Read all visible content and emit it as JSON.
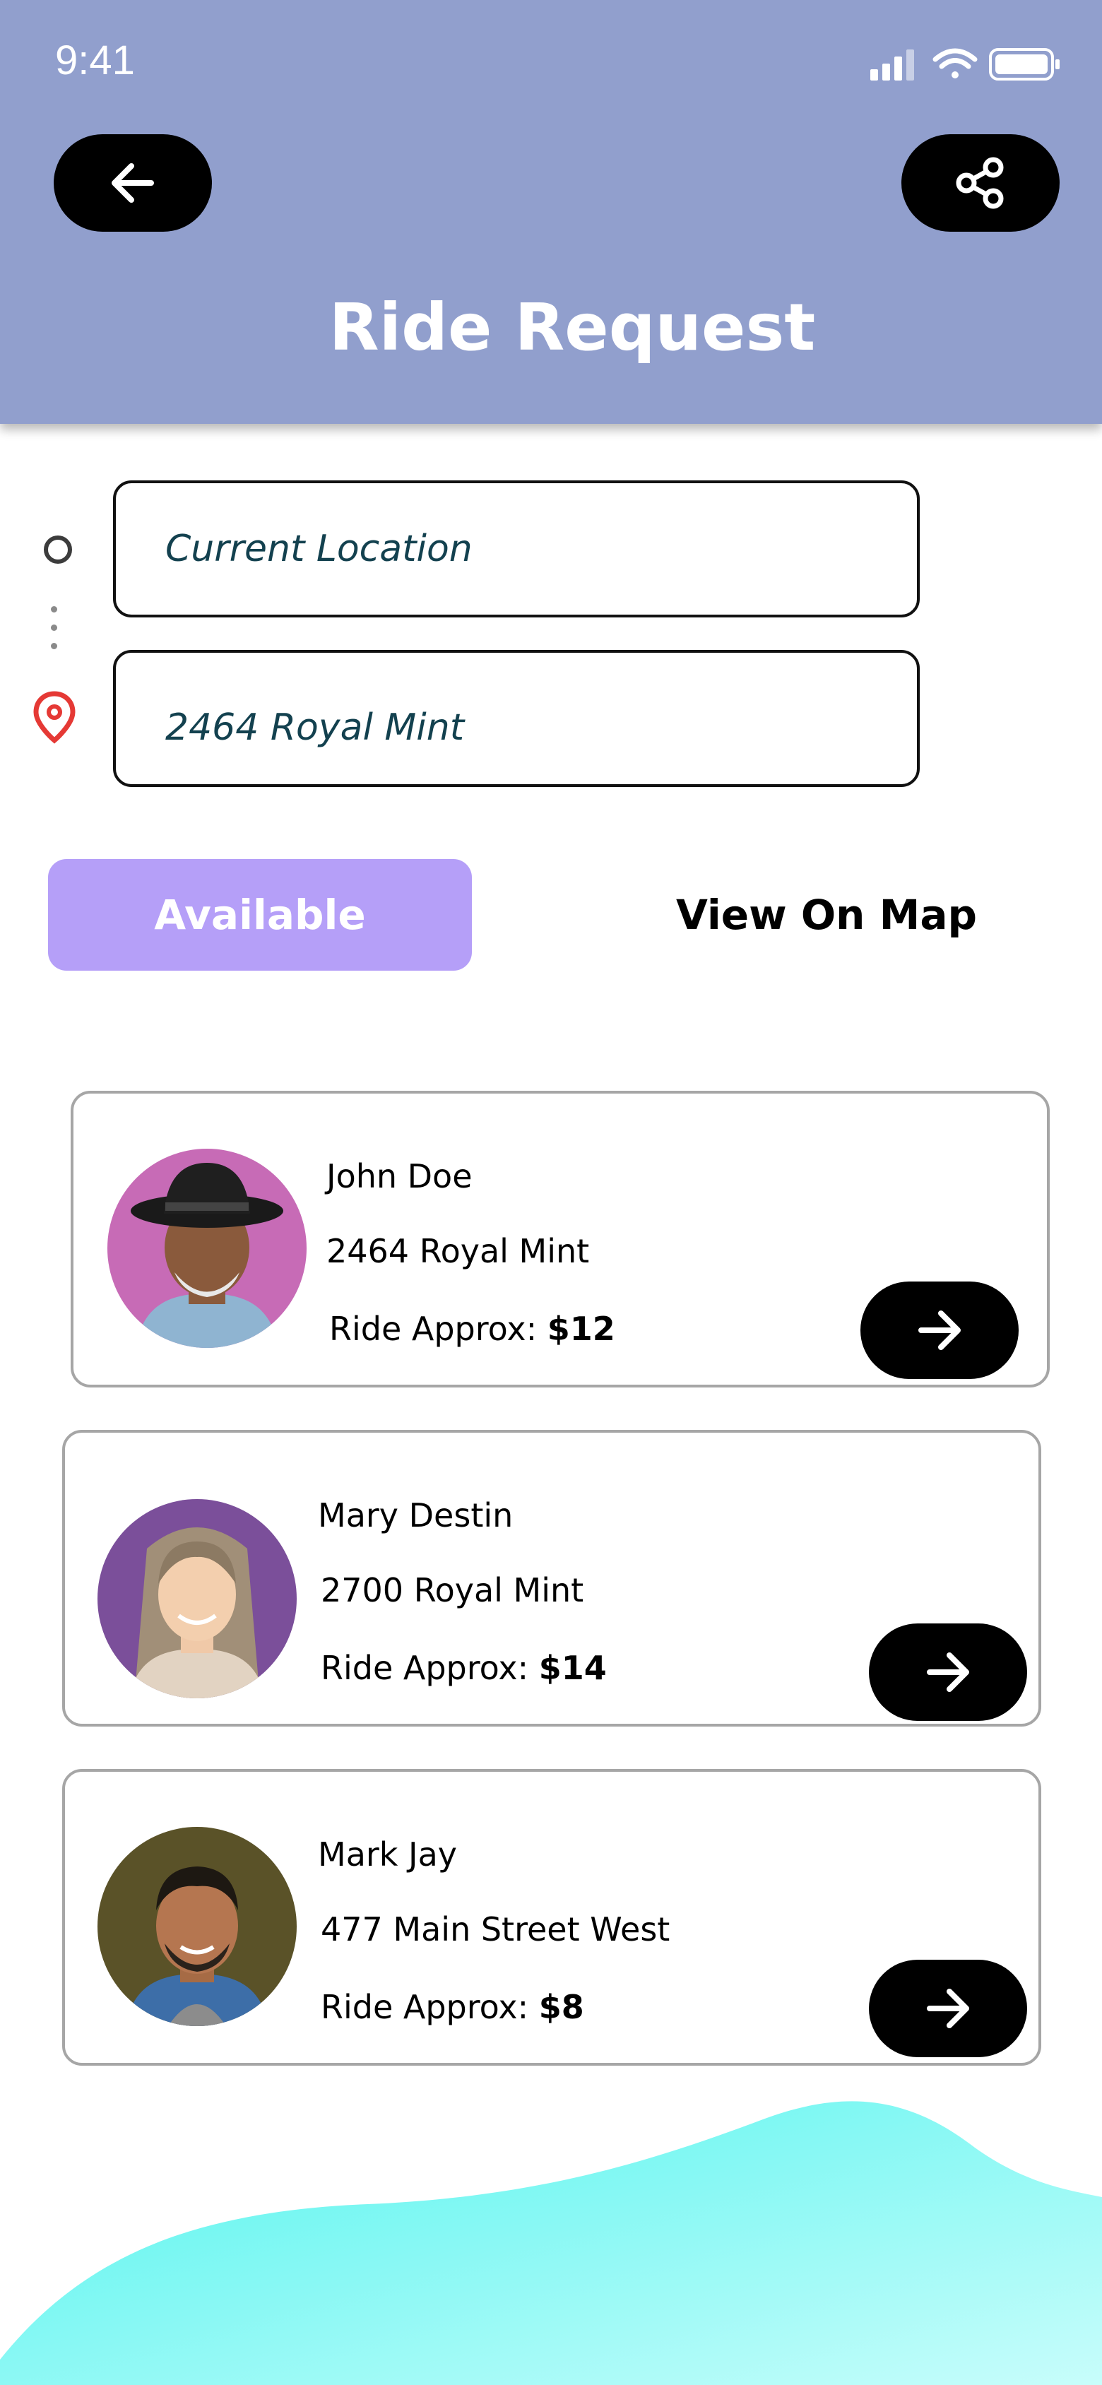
{
  "status_bar": {
    "time": "9:41"
  },
  "header": {
    "title": "Ride Request",
    "back_icon": "arrow-left-icon",
    "share_icon": "share-icon",
    "background": "#919fcd"
  },
  "route": {
    "from_value": "Current Location",
    "to_value": "2464 Royal Mint",
    "pin_color": "#e53935"
  },
  "tabs": {
    "available_label": "Available",
    "map_label": "View On Map",
    "active_color": "#b59ff8"
  },
  "rides": [
    {
      "name": "John Doe",
      "address": "2464 Royal Mint",
      "price_label": "Ride Approx:",
      "price": "$12",
      "avatar_bg": "#c76bb6"
    },
    {
      "name": "Mary Destin",
      "address": "2700 Royal Mint",
      "price_label": "Ride Approx:",
      "price": "$14",
      "avatar_bg": "#7b4f9a"
    },
    {
      "name": "Mark Jay",
      "address": "477 Main Street West",
      "price_label": "Ride Approx:",
      "price": "$8",
      "avatar_bg": "#5a5228"
    }
  ],
  "decor": {
    "wave_colors": [
      "#52f4ee",
      "#c8fdfb"
    ]
  }
}
